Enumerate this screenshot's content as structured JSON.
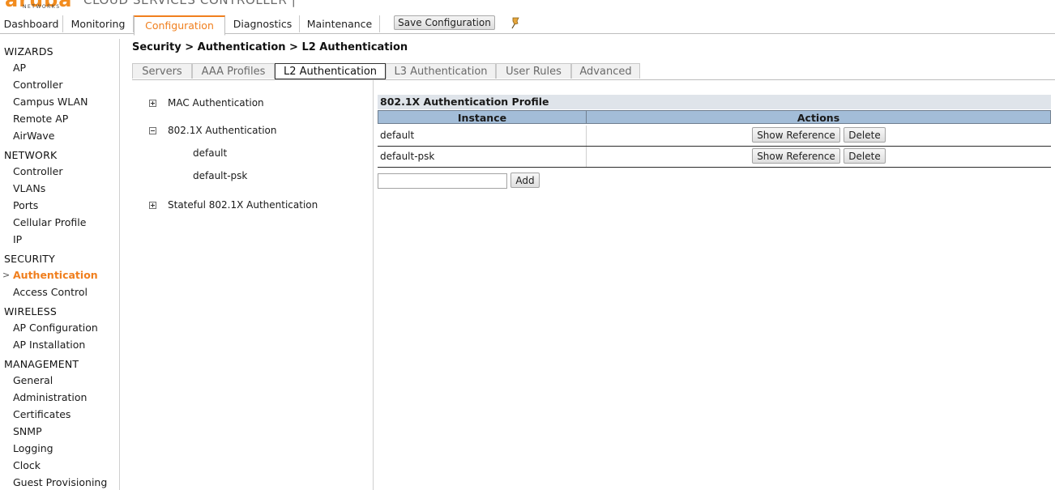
{
  "brand": {
    "logo": "aruba",
    "logo_sub": "NETWORKS",
    "product": "CLOUD SERVICES CONTROLLER |"
  },
  "nav": {
    "tabs": [
      "Dashboard",
      "Monitoring",
      "Configuration",
      "Diagnostics",
      "Maintenance"
    ],
    "active": "Configuration",
    "save_label": "Save Configuration",
    "accent": "#f07f1e"
  },
  "sidebar": {
    "groups": [
      {
        "label": "WIZARDS",
        "items": [
          "AP",
          "Controller",
          "Campus WLAN",
          "Remote AP",
          "AirWave"
        ]
      },
      {
        "label": "NETWORK",
        "items": [
          "Controller",
          "VLANs",
          "Ports",
          "Cellular Profile",
          "IP"
        ]
      },
      {
        "label": "SECURITY",
        "items": [
          "Authentication",
          "Access Control"
        ]
      },
      {
        "label": "WIRELESS",
        "items": [
          "AP Configuration",
          "AP Installation"
        ]
      },
      {
        "label": "MANAGEMENT",
        "items": [
          "General",
          "Administration",
          "Certificates",
          "SNMP",
          "Logging",
          "Clock",
          "Guest Provisioning"
        ]
      }
    ],
    "active": "Authentication",
    "caret": ">"
  },
  "breadcrumb": "Security > Authentication > L2 Authentication",
  "subtabs": {
    "items": [
      "Servers",
      "AAA Profiles",
      "L2 Authentication",
      "L3 Authentication",
      "User Rules",
      "Advanced"
    ],
    "active": "L2 Authentication"
  },
  "tree": {
    "mac": "MAC Authentication",
    "dot1x": "802.1X Authentication",
    "dot1x_children": [
      "default",
      "default-psk"
    ],
    "stateful": "Stateful 802.1X Authentication"
  },
  "profile": {
    "title": "802.1X Authentication Profile",
    "col_instance": "Instance",
    "col_actions": "Actions",
    "rows": [
      {
        "name": "default",
        "show": "Show Reference",
        "delete": "Delete"
      },
      {
        "name": "default-psk",
        "show": "Show Reference",
        "delete": "Delete"
      }
    ],
    "add_value": "",
    "add_label": "Add",
    "header_color": "#a3bdd8"
  }
}
